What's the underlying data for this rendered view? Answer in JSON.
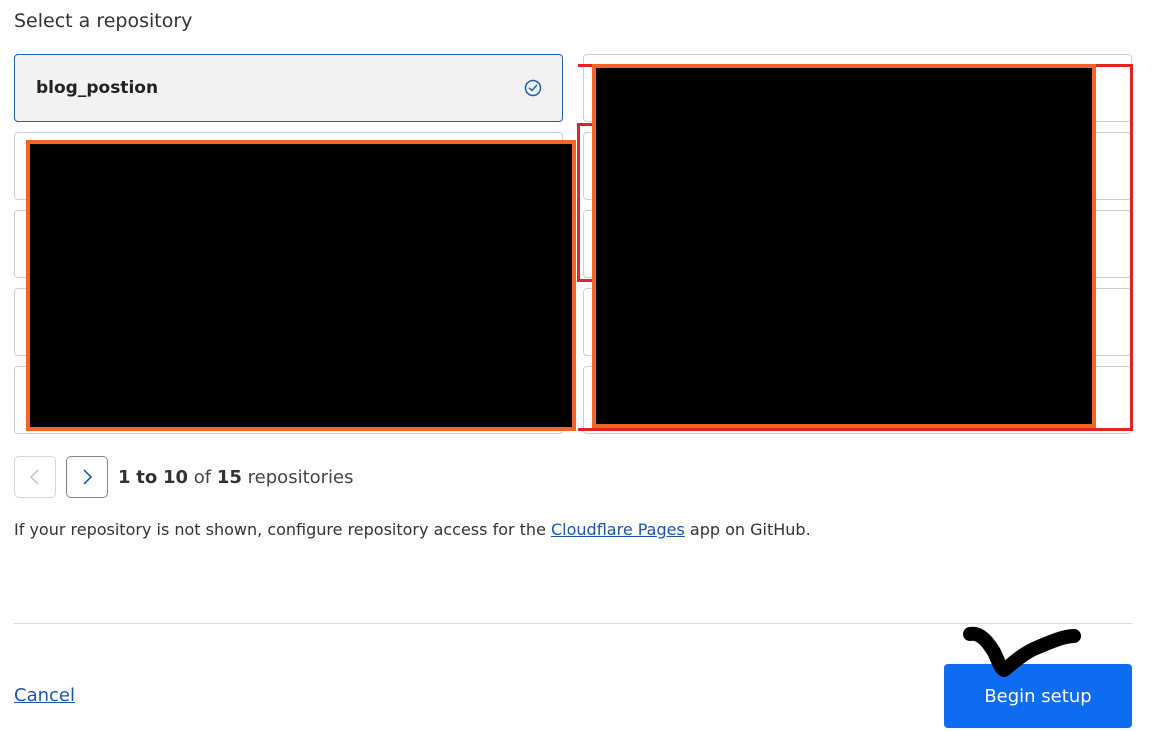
{
  "section": {
    "title": "Select a repository"
  },
  "repositories": {
    "selected": {
      "name": "blog_postion"
    }
  },
  "pagination": {
    "range_start": "1",
    "to": "to",
    "range_end": "10",
    "of": "of",
    "total": "15",
    "unit": "repositories"
  },
  "help": {
    "before": "If your repository is not shown, configure repository access for the ",
    "link": "Cloudflare Pages",
    "after": " app on GitHub."
  },
  "footer": {
    "cancel_label": "Cancel",
    "begin_label": "Begin setup"
  },
  "colors": {
    "accent": "#0d6cf2",
    "link": "#1a56b0",
    "redaction_outline": "#f26522",
    "annotation_red": "#e02424"
  },
  "icons": {
    "selected_check": "check-circle-icon",
    "prev": "chevron-left-icon",
    "next": "chevron-right-icon"
  }
}
